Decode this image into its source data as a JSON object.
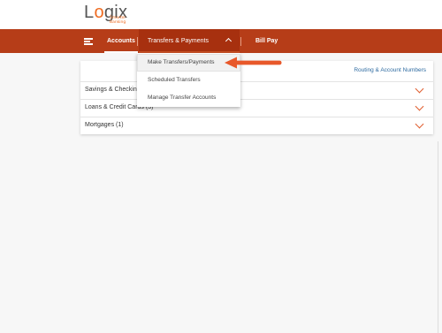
{
  "brand": {
    "name_prefix": "L",
    "name_o": "o",
    "name_suffix": "gix",
    "tagline_line1": "Smarter",
    "tagline_line2": "Banking"
  },
  "nav": {
    "accounts": "Accounts",
    "transfers": "Transfers & Payments",
    "bill_pay": "Bill Pay"
  },
  "dropdown": {
    "items": [
      {
        "label": "Make Transfers/Payments"
      },
      {
        "label": "Scheduled Transfers"
      },
      {
        "label": "Manage Transfer Accounts"
      }
    ]
  },
  "accounts_panel": {
    "routing_link": "Routing & Account Numbers",
    "rows": [
      {
        "label": "Savings & Checking"
      },
      {
        "label": "Loans & Credit Cards (3)"
      },
      {
        "label": "Mortgages (1)"
      }
    ]
  },
  "colors": {
    "nav_bar": "#b63d18",
    "accent_arrow": "#e8582a",
    "link": "#2d6aa0"
  },
  "icons": {
    "menu": "hamburger-icon",
    "transfers_toggle": "chevron-up-icon",
    "row_expand": "chevron-down-icon",
    "annotation": "arrow-left-icon"
  }
}
